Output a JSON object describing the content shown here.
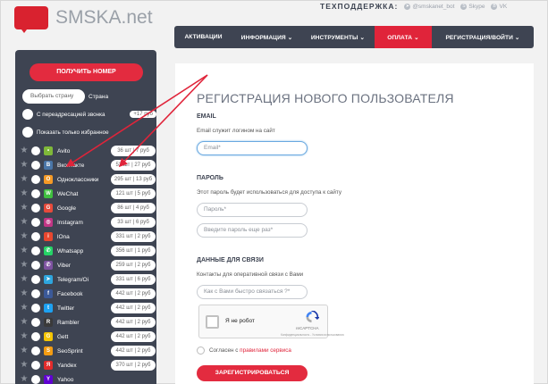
{
  "logo": {
    "text": "SMSKA.net"
  },
  "support": {
    "title": "ТЕХПОДДЕРЖКА:",
    "telegram": "@smskanet_bot",
    "skype": "Skype",
    "vk": "VK"
  },
  "nav": [
    "АКТИВАЦИИ",
    "ИНФОРМАЦИЯ ⌄",
    "ИНСТРУМЕНТЫ ⌄",
    "ОПЛАТА ⌄",
    "РЕГИСТРАЦИЯ/ВОЙТИ ⌄"
  ],
  "nav_active_index": 3,
  "sidebar": {
    "get_number": "ПОЛУЧИТЬ НОМЕР",
    "country_placeholder": "Выбрать страну",
    "country_label": "Страна",
    "redirect_label": "С переадресацией звонка",
    "redirect_badge": "+17 руб",
    "favorites_label": "Показать только избранное",
    "services": [
      {
        "name": "Avito",
        "price": "36 шт | 7 руб",
        "icon": "avito-icon",
        "color": "#7fb839",
        "glyph": "•"
      },
      {
        "name": "Вконтакте",
        "price": "53 шт | 27 руб",
        "icon": "vk-icon",
        "color": "#4a76a8",
        "glyph": "В"
      },
      {
        "name": "Одноклассники",
        "price": "295 шт | 13 руб",
        "icon": "ok-icon",
        "color": "#f59a26",
        "glyph": "О"
      },
      {
        "name": "WeChat",
        "price": "121 шт | 5 руб",
        "icon": "wechat-icon",
        "color": "#3fbf3f",
        "glyph": "W"
      },
      {
        "name": "Google",
        "price": "86 шт | 4 руб",
        "icon": "google-icon",
        "color": "#e64a3b",
        "glyph": "G"
      },
      {
        "name": "Instagram",
        "price": "33 шт | 6 руб",
        "icon": "instagram-icon",
        "color": "#c13584",
        "glyph": "◎"
      },
      {
        "name": "lOna",
        "price": "331 шт | 2 руб",
        "icon": "iona-icon",
        "color": "#e8472f",
        "glyph": "i"
      },
      {
        "name": "Whatsapp",
        "price": "356 шт | 1 руб",
        "icon": "whatsapp-icon",
        "color": "#25d366",
        "glyph": "✆"
      },
      {
        "name": "Viber",
        "price": "259 шт | 2 руб",
        "icon": "viber-icon",
        "color": "#7d52a0",
        "glyph": "✆"
      },
      {
        "name": "Telegram/Oi",
        "price": "331 шт | 6 руб",
        "icon": "telegram-icon",
        "color": "#2ea6de",
        "glyph": "➤"
      },
      {
        "name": "Facebook",
        "price": "442 шт | 2 руб",
        "icon": "facebook-icon",
        "color": "#3b5998",
        "glyph": "f"
      },
      {
        "name": "Twitter",
        "price": "442 шт | 2 руб",
        "icon": "twitter-icon",
        "color": "#1da1f2",
        "glyph": "t"
      },
      {
        "name": "Rambler",
        "price": "442 шт | 2 руб",
        "icon": "rambler-icon",
        "color": "#3a3a3a",
        "glyph": "R"
      },
      {
        "name": "Gett",
        "price": "442 шт | 2 руб",
        "icon": "gett-icon",
        "color": "#f4c400",
        "glyph": "G"
      },
      {
        "name": "SeoSprint",
        "price": "442 шт | 2 руб",
        "icon": "seosprint-icon",
        "color": "#f39c12",
        "glyph": "S"
      },
      {
        "name": "Yandex",
        "price": "370 шт | 2 руб",
        "icon": "yandex-icon",
        "color": "#e32b2b",
        "glyph": "Я"
      },
      {
        "name": "Yahoo",
        "price": "",
        "icon": "yahoo-icon",
        "color": "#6001d2",
        "glyph": "Y"
      }
    ]
  },
  "form": {
    "title": "РЕГИСТРАЦИЯ НОВОГО ПОЛЬЗОВАТЕЛЯ",
    "email_section": "EMAIL",
    "email_desc": "Email служит логином на сайт",
    "email_placeholder": "Email*",
    "password_section": "ПАРОЛЬ",
    "password_desc": "Этот пароль будет использоваться для доступа к сайту",
    "password_placeholder": "Пароль*",
    "password_repeat_placeholder": "Введите пароль еще раз*",
    "contacts_section": "ДАННЫЕ ДЛЯ СВЯЗИ",
    "contacts_desc": "Контакты для оперативной связи с Вами",
    "contacts_placeholder": "Как с Вами быстро связаться ?*",
    "captcha_label": "Я не робот",
    "captcha_brand": "reCAPTCHA",
    "captcha_terms": "Конфиденциальность - Условия использования",
    "agree_text": "Согласен с",
    "agree_link": "правилами сервиса",
    "submit": "ЗАРЕГИСТРИРОВАТЬСЯ"
  },
  "colors": {
    "accent": "#e32b3f",
    "dark": "#3e4452",
    "focus": "#6aa9e0"
  }
}
